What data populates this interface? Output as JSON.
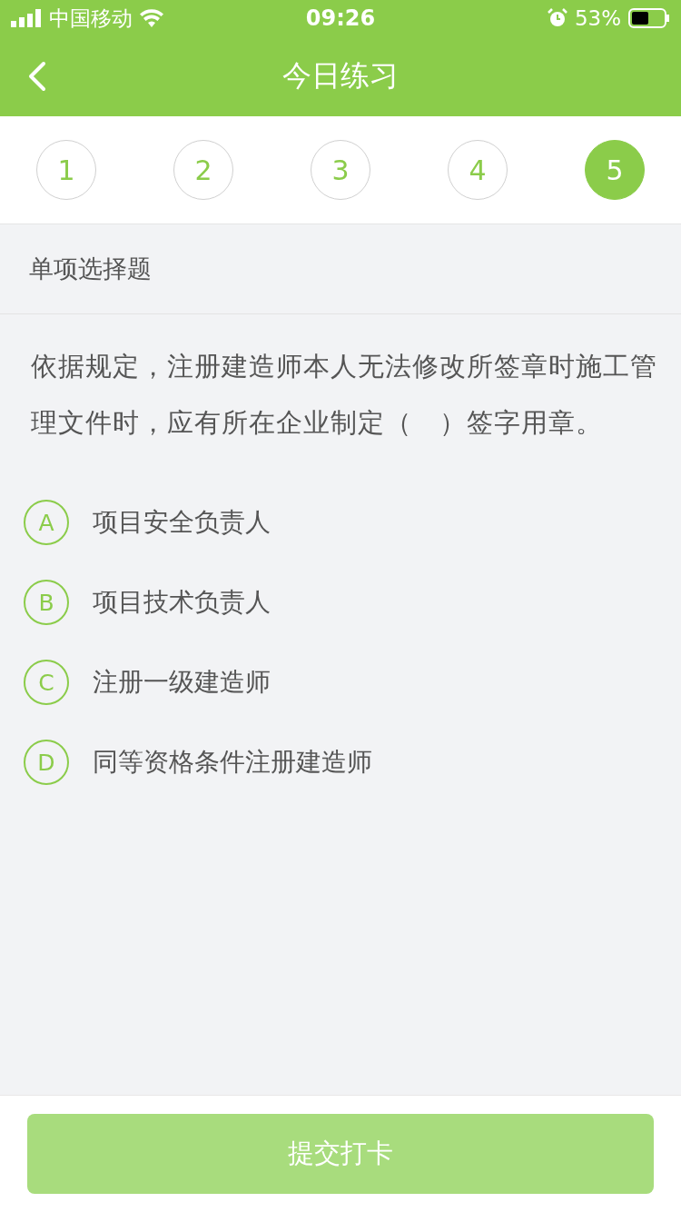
{
  "status_bar": {
    "carrier": "中国移动",
    "time": "09:26",
    "battery": "53%"
  },
  "nav": {
    "title": "今日练习"
  },
  "question_tabs": [
    {
      "label": "1",
      "selected": false
    },
    {
      "label": "2",
      "selected": false
    },
    {
      "label": "3",
      "selected": false
    },
    {
      "label": "4",
      "selected": false
    },
    {
      "label": "5",
      "selected": true
    }
  ],
  "question": {
    "type": "单项选择题",
    "text": "依据规定，注册建造师本人无法修改所签章时施工管理文件时，应有所在企业制定（　）签字用章。",
    "options": [
      {
        "letter": "A",
        "text": "项目安全负责人",
        "selected": false
      },
      {
        "letter": "B",
        "text": "项目技术负责人",
        "selected": false
      },
      {
        "letter": "C",
        "text": "注册一级建造师",
        "selected": false
      },
      {
        "letter": "D",
        "text": "同等资格条件注册建造师",
        "selected": false
      }
    ]
  },
  "submit": {
    "label": "提交打卡",
    "disabled": true
  }
}
